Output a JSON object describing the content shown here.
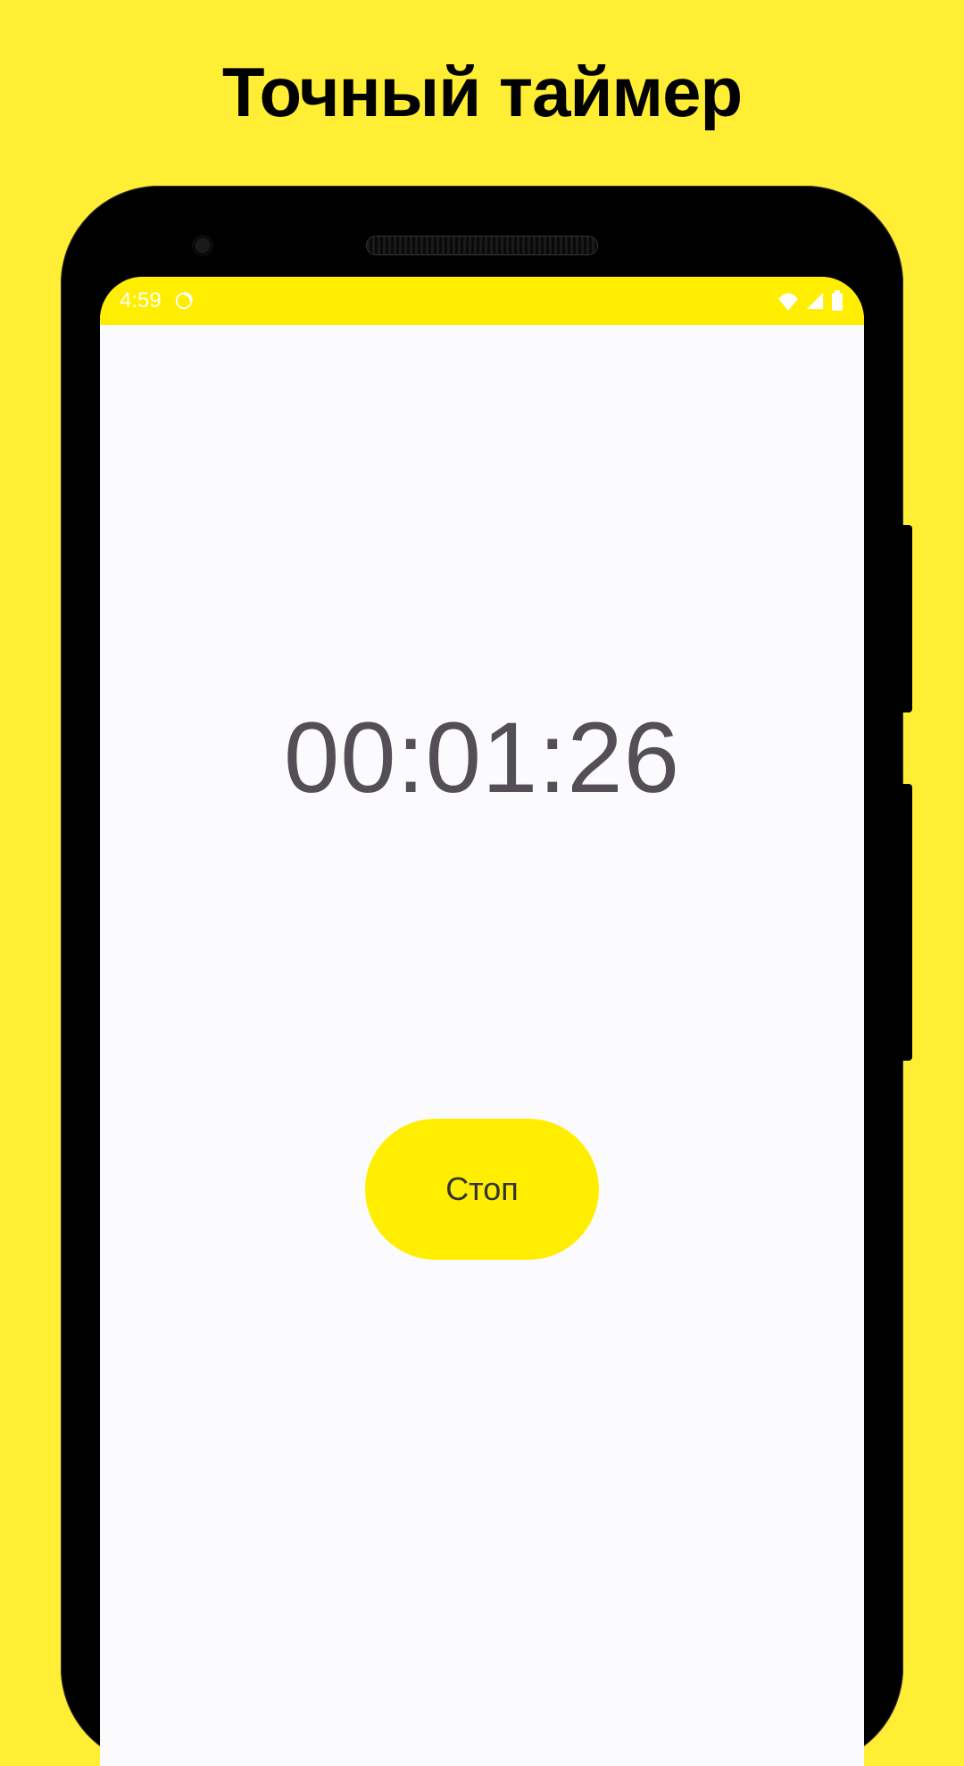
{
  "page": {
    "title": "Точный таймер"
  },
  "statusbar": {
    "time": "4:59"
  },
  "app": {
    "timer": "00:01:26",
    "stop_label": "Стоп"
  },
  "colors": {
    "background": "#FFEE33",
    "accent": "#FFEE00",
    "text_dark": "#000000",
    "timer_text": "#544E56"
  },
  "icons": {
    "status_left": "timer-icon",
    "status_right": [
      "wifi-icon",
      "cell-signal-icon",
      "battery-icon"
    ]
  }
}
